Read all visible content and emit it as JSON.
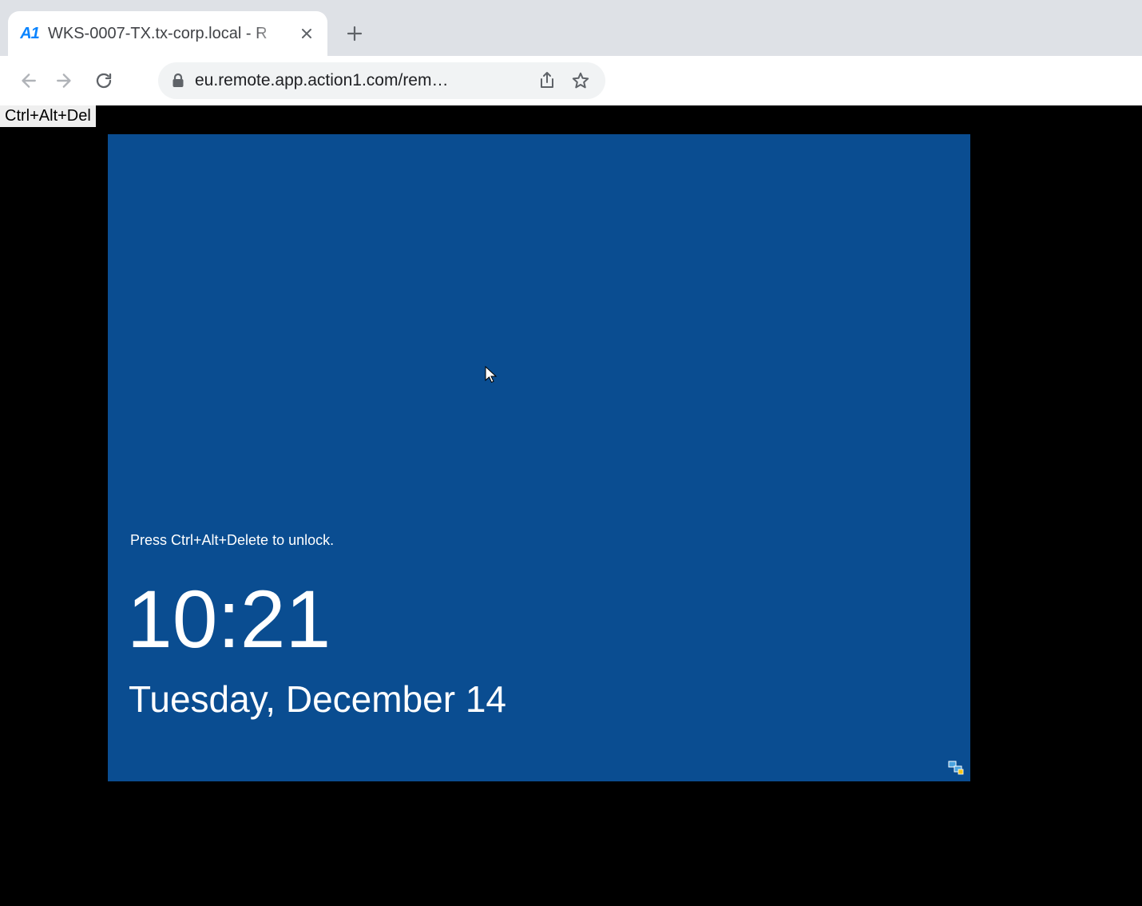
{
  "browser": {
    "tab": {
      "favicon_label": "A1",
      "title": "WKS-0007-TX.tx-corp.local - R"
    },
    "url": "eu.remote.app.action1.com/rem…"
  },
  "session": {
    "cad_button_label": "Ctrl+Alt+Del",
    "lockscreen": {
      "hint": "Press Ctrl+Alt+Delete to unlock.",
      "time": "10:21",
      "date": "Tuesday, December 14"
    }
  }
}
